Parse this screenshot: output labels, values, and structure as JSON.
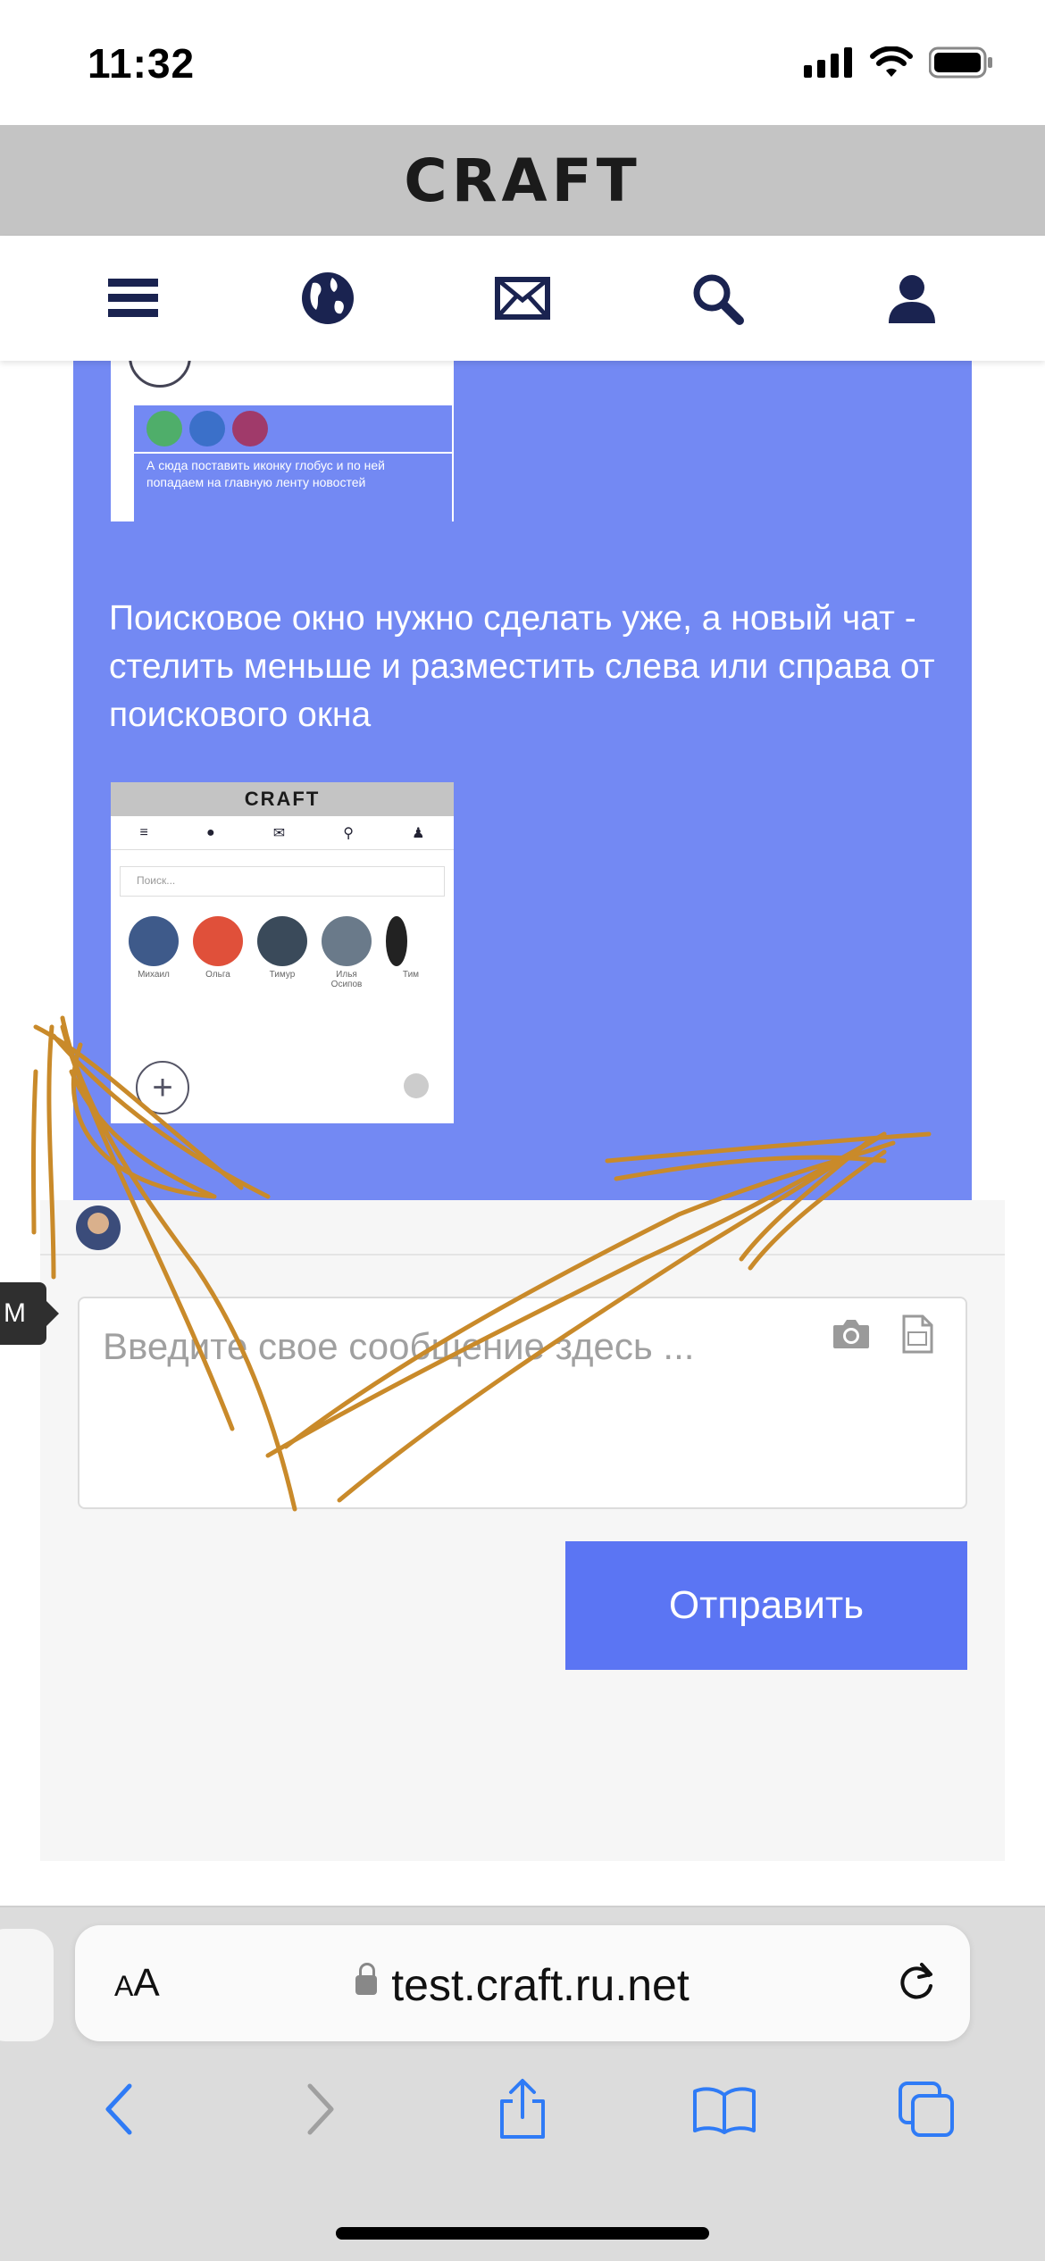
{
  "status_bar": {
    "time": "11:32"
  },
  "site": {
    "logo": "CRAFT"
  },
  "nav": {
    "items": [
      {
        "icon": "menu-icon"
      },
      {
        "icon": "globe-icon"
      },
      {
        "icon": "mail-icon"
      },
      {
        "icon": "search-icon"
      },
      {
        "icon": "user-icon"
      }
    ]
  },
  "chat": {
    "screenshot_top": {
      "caption": "А сюда поставить иконку глобус и по ней попадаем на главную ленту новостей"
    },
    "text_message": "Поисковое окно нужно сделать уже, а новый чат - стелить меньше и разместить слева или справа от поискового окна",
    "screenshot_bottom": {
      "logo": "CRAFT",
      "search_placeholder": "Поиск...",
      "contacts": [
        "Михаил",
        "Ольга",
        "Тимур",
        "Илья Осипов",
        "Тим"
      ]
    },
    "side_tab_label": "M"
  },
  "composer": {
    "placeholder": "Введите свое сообщение здесь ...",
    "send_label": "Отправить"
  },
  "browser": {
    "aa_small": "A",
    "aa_large": "A",
    "url": "test.craft.ru.net"
  },
  "colors": {
    "card_bg": "#7389f3",
    "send_bg": "#5b75f3",
    "header_bg": "#c4c4c4",
    "scribble": "#c98a2a",
    "nav_icon": "#1a2350"
  }
}
